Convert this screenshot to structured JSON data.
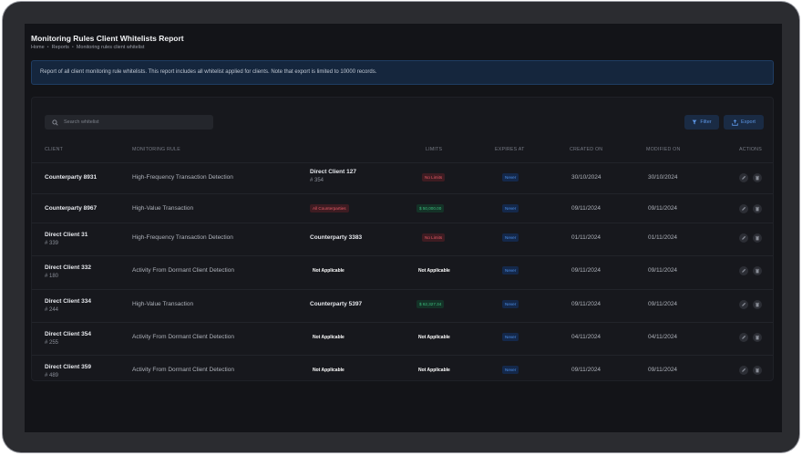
{
  "page": {
    "title": "Monitoring Rules Client Whitelists Report",
    "breadcrumb": [
      "Home",
      "Reports",
      "Monitoring rules client whitelist"
    ],
    "breadcrumb_sep": "•",
    "info": "Report of all client monitoring rule whitelists. This report includes all whitelist applied for clients. Note that export is limited to 10000 records."
  },
  "toolbar": {
    "search_placeholder": "Search whitelist",
    "filter_label": "Filter",
    "export_label": "Export"
  },
  "table": {
    "headers": {
      "client": "CLIENT",
      "rule": "MONITORING RULE",
      "limits": "LIMITS",
      "expires": "EXPIRES AT",
      "created": "CREATED ON",
      "modified": "MODIFIED ON",
      "actions": "ACTIONS"
    },
    "rows": [
      {
        "client": "Counterparty 8931",
        "client_id": "",
        "rule": "High-Frequency Transaction Detection",
        "cp": "Direct Client 127",
        "cp_id": "# 354",
        "cp_badge": "",
        "limit": "No Limits",
        "limit_color": "red",
        "expires": "Never",
        "created": "30/10/2024",
        "modified": "30/10/2024"
      },
      {
        "client": "Counterparty 8967",
        "client_id": "",
        "rule": "High-Value Transaction",
        "cp": "",
        "cp_id": "",
        "cp_badge": "All Counterparties",
        "limit": "$ 50,000.00",
        "limit_color": "green",
        "expires": "Never",
        "created": "09/11/2024",
        "modified": "09/11/2024"
      },
      {
        "client": "Direct Client 31",
        "client_id": "# 339",
        "rule": "High-Frequency Transaction Detection",
        "cp": "Counterparty 3383",
        "cp_id": "",
        "cp_badge": "",
        "limit": "No Limits",
        "limit_color": "red",
        "expires": "Never",
        "created": "01/11/2024",
        "modified": "01/11/2024"
      },
      {
        "client": "Direct Client 332",
        "client_id": "# 180",
        "rule": "Activity From Dormant Client Detection",
        "cp": "Not Applicable",
        "cp_id": "",
        "cp_badge": "",
        "limit": "Not Applicable",
        "limit_color": "none",
        "expires": "Never",
        "created": "09/11/2024",
        "modified": "09/11/2024"
      },
      {
        "client": "Direct Client 334",
        "client_id": "# 244",
        "rule": "High-Value Transaction",
        "cp": "Counterparty 5397",
        "cp_id": "",
        "cp_badge": "",
        "limit": "$ 62,327.34",
        "limit_color": "green",
        "expires": "Never",
        "created": "09/11/2024",
        "modified": "09/11/2024"
      },
      {
        "client": "Direct Client 354",
        "client_id": "# 255",
        "rule": "Activity From Dormant Client Detection",
        "cp": "Not Applicable",
        "cp_id": "",
        "cp_badge": "",
        "limit": "Not Applicable",
        "limit_color": "none",
        "expires": "Never",
        "created": "04/11/2024",
        "modified": "04/11/2024"
      },
      {
        "client": "Direct Client 359",
        "client_id": "# 489",
        "rule": "Activity From Dormant Client Detection",
        "cp": "Not Applicable",
        "cp_id": "",
        "cp_badge": "",
        "limit": "Not Applicable",
        "limit_color": "none",
        "expires": "Never",
        "created": "09/11/2024",
        "modified": "09/11/2024"
      }
    ]
  },
  "icons": {
    "search": "search-icon",
    "filter": "filter-icon",
    "export": "export-icon",
    "edit": "pencil-icon",
    "delete": "trash-icon"
  },
  "colors": {
    "accent": "#4d8fe8",
    "danger": "#e55a66",
    "success": "#3dbd7d"
  }
}
